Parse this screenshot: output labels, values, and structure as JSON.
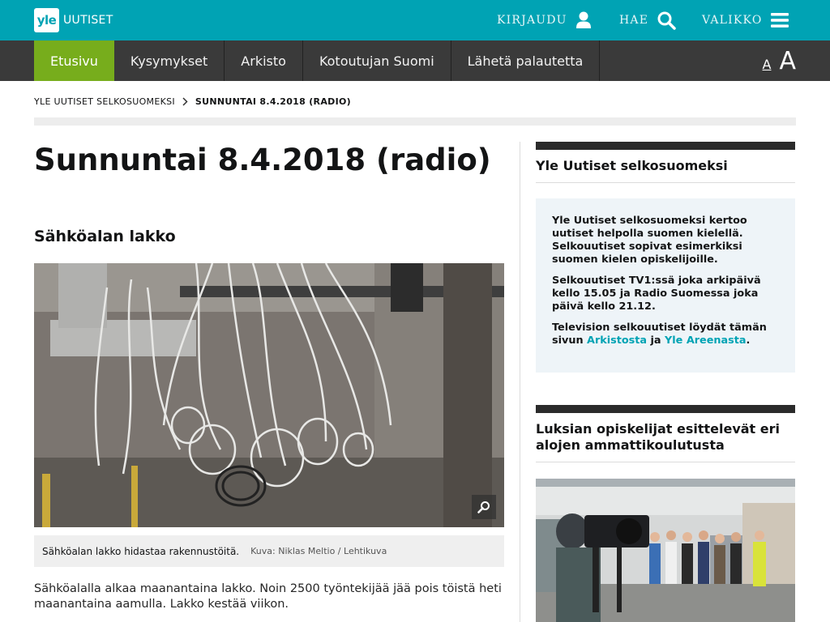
{
  "header": {
    "logo_mark": "yle",
    "logo_text": "UUTISET",
    "login_label": "KIRJAUDU",
    "search_label": "HAE",
    "menu_label": "VALIKKO"
  },
  "nav": {
    "items": [
      {
        "label": "Etusivu",
        "active": true
      },
      {
        "label": "Kysymykset"
      },
      {
        "label": "Arkisto"
      },
      {
        "label": "Kotoutujan Suomi"
      },
      {
        "label": "Lähetä palautetta"
      }
    ],
    "font_small": "A",
    "font_large": "A"
  },
  "breadcrumb": {
    "parent": "YLE UUTISET SELKOSUOMEKSI",
    "current": "SUNNUNTAI 8.4.2018 (RADIO)"
  },
  "article": {
    "title": "Sunnuntai 8.4.2018 (radio)",
    "section_title": "Sähköalan lakko",
    "image_caption": "Sähköalan lakko hidastaa rakennustöitä.",
    "image_credit": "Kuva: Niklas Meltio / Lehtikuva",
    "body": "Sähköalalla alkaa maanantaina lakko. Noin 2500 työntekijää jää pois töistä heti maanantaina aamulla. Lakko kestää viikon."
  },
  "sidebar": {
    "box_title": "Yle Uutiset selkosuomeksi",
    "info_p1": "Yle Uutiset selkosuomeksi kertoo uutiset helpolla suomen kielellä. Selkouutiset sopivat esimerkiksi suomen kielen opiskelijoille.",
    "info_p2": "Selkouutiset TV1:ssä joka arkipäivä kello 15.05 ja Radio Suomessa joka päivä kello 21.12.",
    "info_p3_prefix": "Television selkouutiset löydät tämän sivun",
    "info_link1": "Arkistosta",
    "info_and": "ja",
    "info_link2": "Yle Areenasta",
    "info_p3_suffix": ".",
    "story_title": "Luksian opiskelijat esittelevät eri alojen ammattikoulutusta"
  },
  "colors": {
    "brand_teal": "#00a3b4",
    "nav_dark": "#3a3a3a",
    "nav_active": "#77ad1c",
    "info_bg": "#eef4f8"
  },
  "icons": [
    "user-icon",
    "search-icon",
    "menu-icon",
    "chevron-right-icon",
    "zoom-icon"
  ]
}
